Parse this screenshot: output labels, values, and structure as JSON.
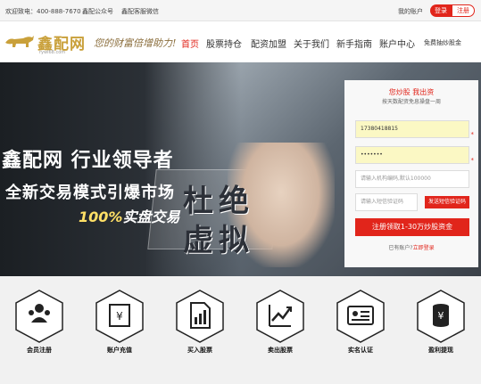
{
  "topbar": {
    "hotline": "欢迎致电：400-888-7670",
    "wechat_public": "鑫配公众号",
    "wechat_service": "鑫配客服微信",
    "my_account": "我的账户",
    "login": "登录",
    "register": "注册"
  },
  "header": {
    "logo_text": "鑫配网",
    "logo_url": "rywl68.com",
    "slogan": "您的财富倍增助力!",
    "nav": [
      "首页",
      "股票持仓",
      "配资加盟",
      "关于我们",
      "新手指南",
      "账户中心"
    ],
    "nav_extra": "免费抽炒股金"
  },
  "banner": {
    "title": "鑫配网 行业领导者",
    "subtitle": "全新交易模式引爆市场",
    "percent": "100%",
    "percent_text": "实盘交易",
    "char1": "杜",
    "char2": "绝",
    "char3": "虚",
    "char4": "拟"
  },
  "form": {
    "title": "您炒股 我出资",
    "subtitle": "按天数配资免息操盘一周",
    "phone_value": "17380418815",
    "password_value": "•••••••",
    "org_code_placeholder": "请输入机构编码,默认100000",
    "sms_placeholder": "请输入短信验证码",
    "sms_button": "发送短信验证码",
    "submit": "注册领取1-30万炒股资金",
    "has_account": "已有账户?",
    "login_link": "立即登录"
  },
  "steps": [
    {
      "label": "会员注册",
      "icon": "member-register-icon"
    },
    {
      "label": "账户充值",
      "icon": "account-recharge-icon"
    },
    {
      "label": "买入股票",
      "icon": "buy-stock-icon"
    },
    {
      "label": "卖出股票",
      "icon": "sell-stock-icon"
    },
    {
      "label": "实名认证",
      "icon": "id-verify-icon"
    },
    {
      "label": "盈利提现",
      "icon": "profit-withdraw-icon"
    }
  ],
  "colors": {
    "accent": "#e1251b",
    "gold": "#c9a03a"
  }
}
